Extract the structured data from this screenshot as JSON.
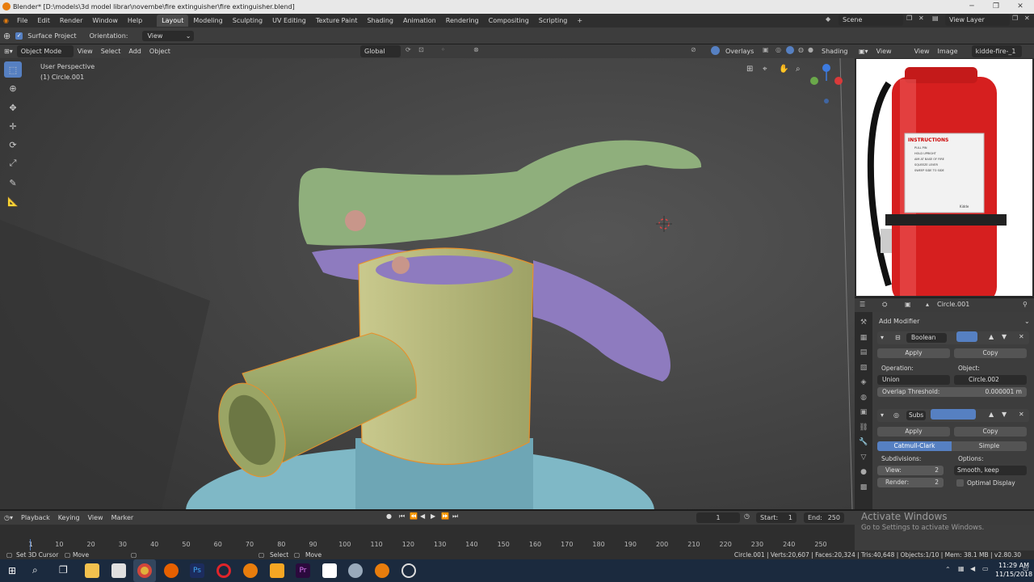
{
  "window": {
    "title": "Blender* [D:\\models\\3d model librar\\novembe\\fire extinguisher\\fire extinguisher.blend]"
  },
  "menu": {
    "items": [
      "File",
      "Edit",
      "Render",
      "Window",
      "Help"
    ]
  },
  "workspaces": [
    "Layout",
    "Modeling",
    "Sculpting",
    "UV Editing",
    "Texture Paint",
    "Shading",
    "Animation",
    "Rendering",
    "Compositing",
    "Scripting"
  ],
  "active_workspace": "Layout",
  "scene": {
    "name": "Scene",
    "view_layer": "View Layer"
  },
  "tool_header": {
    "surface_project_label": "Surface Project",
    "orientation_label": "Orientation:",
    "orientation_value": "View"
  },
  "viewport_header": {
    "mode": "Object Mode",
    "menus": [
      "View",
      "Select",
      "Add",
      "Object"
    ],
    "transform": "Global",
    "overlays": "Overlays",
    "shading": "Shading"
  },
  "viewport": {
    "perspective": "User Perspective",
    "active_object": "(1) Circle.001"
  },
  "image_editor": {
    "menus": [
      "View",
      "View",
      "Image"
    ],
    "image_name": "kidde-fire-_1",
    "label_title": "INSTRUCTIONS",
    "label_lines": [
      "PULL PIN",
      "HOLD UPRIGHT",
      "AIM AT BASE OF FIRE",
      "SQUEEZE LEVER",
      "SWEEP SIDE TO SIDE"
    ],
    "brand": "Kidde"
  },
  "properties": {
    "object_name": "Circle.001",
    "add_modifier": "Add Modifier",
    "boolean": {
      "name": "Boolean",
      "apply": "Apply",
      "copy": "Copy",
      "operation_label": "Operation:",
      "operation_value": "Union",
      "object_label": "Object:",
      "object_value": "Circle.002",
      "overlap_label": "Overlap Threshold:",
      "overlap_value": "0.000001 m"
    },
    "subsurf": {
      "name": "Subs",
      "apply": "Apply",
      "copy": "Copy",
      "catmull": "Catmull-Clark",
      "simple": "Simple",
      "subdivisions_label": "Subdivisions:",
      "options_label": "Options:",
      "view_label": "View:",
      "view_value": "2",
      "render_label": "Render:",
      "render_value": "2",
      "uv_smooth": "Smooth, keep corners",
      "optimal_display": "Optimal Display"
    }
  },
  "timeline": {
    "menus": [
      "Playback",
      "Keying",
      "View",
      "Marker"
    ],
    "current_frame": "1",
    "start_label": "Start:",
    "start": "1",
    "end_label": "End:",
    "end": "250",
    "ticks": [
      "1",
      "10",
      "20",
      "30",
      "40",
      "50",
      "60",
      "70",
      "80",
      "90",
      "100",
      "110",
      "120",
      "130",
      "140",
      "150",
      "160",
      "170",
      "180",
      "190",
      "200",
      "210",
      "220",
      "230",
      "240",
      "250"
    ]
  },
  "activate": {
    "title": "Activate Windows",
    "subtitle": "Go to Settings to activate Windows."
  },
  "statusbar": {
    "left": [
      "Set 3D Cursor",
      "Move",
      "Select",
      "Move"
    ],
    "stats": "Circle.001 | Verts:20,607 | Faces:20,324 | Tris:40,648 | Objects:1/10 | Mem: 38.1 MB | v2.80.30"
  },
  "taskbar": {
    "time": "11:29 AM",
    "date": "11/15/2018"
  },
  "colors": {
    "accent": "#5680c2",
    "selection": "#e8902a",
    "nozzle": "#a5b56c",
    "handle": "#8faf7c",
    "lever": "#8e7bbf",
    "body": "#7fb8c6"
  }
}
